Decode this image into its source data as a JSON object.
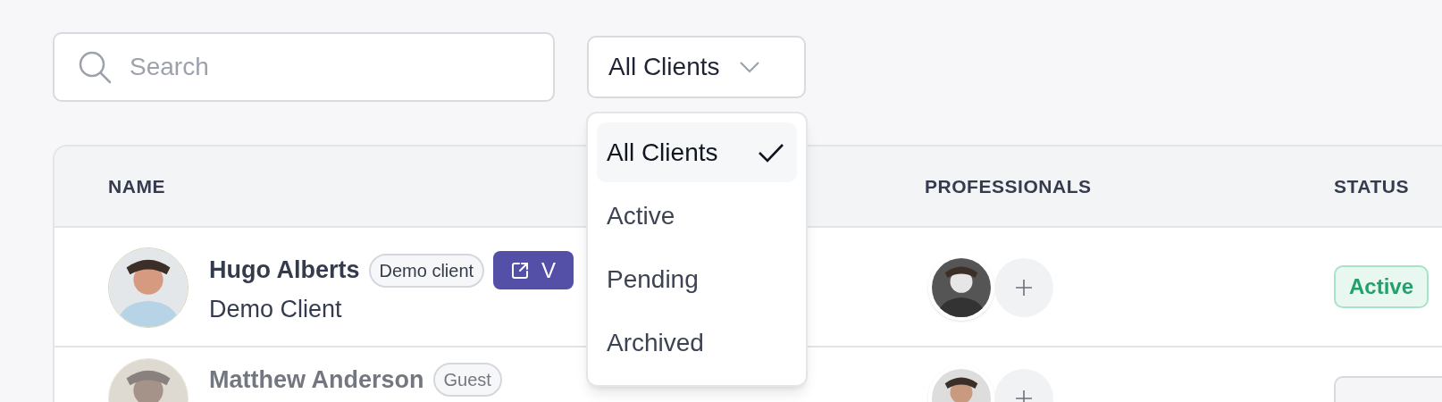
{
  "search": {
    "placeholder": "Search"
  },
  "filter": {
    "value": "All Clients",
    "open": true,
    "options": [
      {
        "label": "All Clients",
        "selected": true
      },
      {
        "label": "Active",
        "selected": false
      },
      {
        "label": "Pending",
        "selected": false
      },
      {
        "label": "Archived",
        "selected": false
      }
    ]
  },
  "table": {
    "columns": [
      "NAME",
      "PROFESSIONALS",
      "STATUS"
    ],
    "rows": [
      {
        "name": "Hugo Alberts",
        "tag": "Demo client",
        "action": "V",
        "subtitle": "Demo Client",
        "muted": false,
        "status": {
          "label": "Active",
          "kind": "active"
        }
      },
      {
        "name": "Matthew Anderson",
        "tag": "Guest",
        "muted": true,
        "status": {
          "kind": "neutral"
        }
      }
    ]
  }
}
